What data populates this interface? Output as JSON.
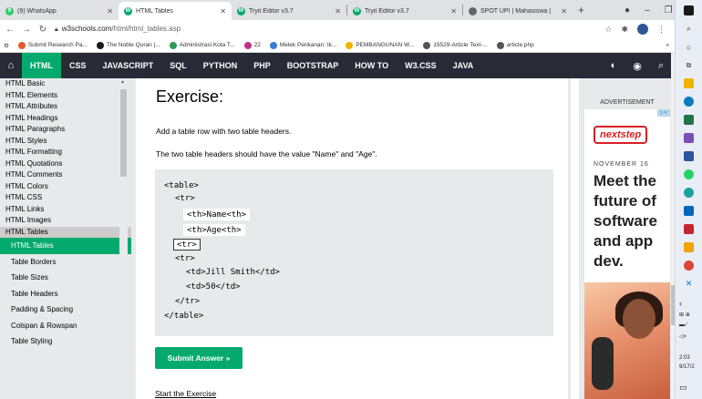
{
  "browser": {
    "tabs": [
      {
        "label": "(9) WhatsApp",
        "icon": "whatsapp-icon",
        "color": "#25d366",
        "badge": "9",
        "width": 130,
        "active": false
      },
      {
        "label": "HTML Tables",
        "icon": "w3schools-icon",
        "color": "#04aa6d",
        "badge": "W",
        "width": 124,
        "active": true
      },
      {
        "label": "Tryit Editor v3.7",
        "icon": "w3schools-icon",
        "color": "#04aa6d",
        "badge": "W",
        "width": 126,
        "active": false
      },
      {
        "label": "Tryit Editor v3.7",
        "icon": "w3schools-icon",
        "color": "#04aa6d",
        "badge": "W",
        "width": 126,
        "active": false
      },
      {
        "label": "SPOT UPI | Mahasiswa |",
        "icon": "globe-icon",
        "color": "#666666",
        "badge": "",
        "width": 120,
        "active": false
      }
    ],
    "new_tab": "+",
    "url_host": "w3schools.com",
    "url_path": "/html/html_tables.asp",
    "bookmarks": [
      {
        "label": "Submit Research Pa...",
        "color": "#e05e2b"
      },
      {
        "label": "The Noble Quran |...",
        "color": "#1a1a1a"
      },
      {
        "label": "Administrasi Kota T...",
        "color": "#2b9c58"
      },
      {
        "label": "22",
        "color": "#c13584"
      },
      {
        "label": "Melek Perikanan: Ik...",
        "color": "#3a7bd5"
      },
      {
        "label": "PEMBANGUNAN W...",
        "color": "#f0b400"
      },
      {
        "label": "15529-Article Text-...",
        "color": "#555555"
      },
      {
        "label": "article.php",
        "color": "#555555"
      }
    ],
    "bookmarks_more": "»"
  },
  "w3nav": {
    "items": [
      "HTML",
      "CSS",
      "JAVASCRIPT",
      "SQL",
      "PYTHON",
      "PHP",
      "BOOTSTRAP",
      "HOW TO",
      "W3.CSS",
      "JAVA"
    ],
    "active": "HTML"
  },
  "sidebar": {
    "items": [
      "HTML Basic",
      "HTML Elements",
      "HTML Attributes",
      "HTML Headings",
      "HTML Paragraphs",
      "HTML Styles",
      "HTML Formatting",
      "HTML Quotations",
      "HTML Comments",
      "HTML Colors",
      "HTML CSS",
      "HTML Links",
      "HTML Images"
    ],
    "section": "HTML Tables",
    "subitems": [
      "HTML Tables",
      "Table Borders",
      "Table Sizes",
      "Table Headers",
      "Padding & Spacing",
      "Colspan & Rowspan",
      "Table Styling"
    ],
    "active_sub": "HTML Tables"
  },
  "exercise": {
    "title": "Exercise:",
    "instruction1": "Add a table row with two table headers.",
    "instruction2": "The two table headers should have the value \"Name\" and \"Age\".",
    "code": {
      "l1": "<table>",
      "l2": "<tr>",
      "l3_input": "<th>Name<th>",
      "l4_input": "<th>Age<th>",
      "l5_input": "<tr>",
      "l6": "<tr>",
      "l7": "<td>Jill Smith</td>",
      "l8": "<td>50</td>",
      "l9": "</tr>",
      "l10": "</table>"
    },
    "submit_label": "Submit Answer »",
    "start_link": "Start the Exercise"
  },
  "ad": {
    "label": "ADVERTISEMENT",
    "brand": "nextstep",
    "date": "NOVEMBER 16",
    "headline": "Meet the future of software and app dev."
  },
  "windows": {
    "time": "2:03",
    "date": "9/17/2"
  }
}
